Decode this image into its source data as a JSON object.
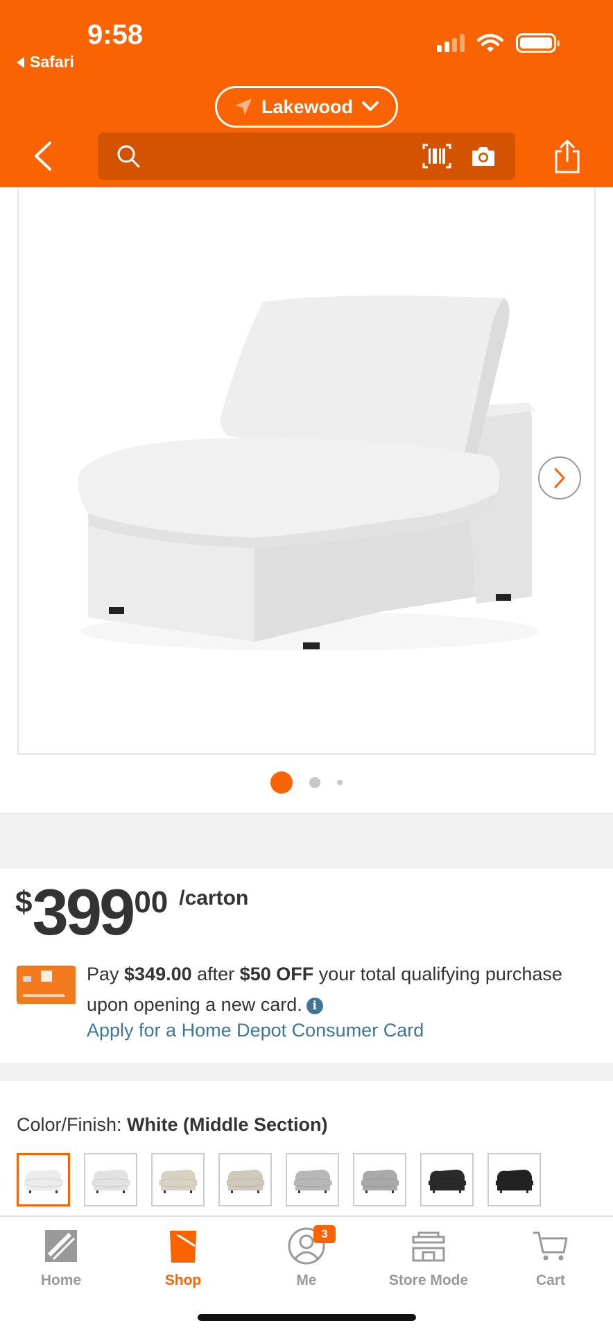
{
  "status_bar": {
    "time": "9:58",
    "back_app": "Safari"
  },
  "header": {
    "store_name": "Lakewood",
    "search": {
      "placeholder": "",
      "value": ""
    }
  },
  "gallery": {
    "total_images": 3,
    "active_index": 0
  },
  "price": {
    "currency": "$",
    "dollars": "399",
    "cents": "00",
    "unit": "/carton"
  },
  "promo": {
    "pay_prefix": "Pay ",
    "pay_amount": "$349.00",
    "after": " after ",
    "discount": "$50 OFF",
    "rest": " your total qualifying purchase upon opening a new card.",
    "apply_link": "Apply for a Home Depot Consumer Card"
  },
  "color": {
    "label": "Color/Finish: ",
    "value": "White (Middle Section)",
    "swatches": [
      {
        "name": "white-middle",
        "color": "#ececec",
        "selected": true
      },
      {
        "name": "white-corner",
        "color": "#e2e2e2",
        "selected": false
      },
      {
        "name": "beige-corner",
        "color": "#d8d2c2",
        "selected": false
      },
      {
        "name": "beige-middle",
        "color": "#cfc9bd",
        "selected": false
      },
      {
        "name": "gray-corner",
        "color": "#b7b7b7",
        "selected": false
      },
      {
        "name": "gray-middle",
        "color": "#a9a9a9",
        "selected": false
      },
      {
        "name": "black-middle",
        "color": "#2a2a2a",
        "selected": false
      },
      {
        "name": "black-corner",
        "color": "#222222",
        "selected": false
      }
    ]
  },
  "tabs": [
    {
      "label": "Home",
      "icon": "home-depot-logo-icon",
      "active": false
    },
    {
      "label": "Shop",
      "icon": "shop-bucket-icon",
      "active": true
    },
    {
      "label": "Me",
      "icon": "profile-icon",
      "active": false,
      "badge": "3"
    },
    {
      "label": "Store Mode",
      "icon": "store-icon",
      "active": false
    },
    {
      "label": "Cart",
      "icon": "cart-icon",
      "active": false
    }
  ],
  "colors": {
    "brand": "#f96302",
    "link": "#3e7697",
    "search_bg": "#d45300"
  }
}
